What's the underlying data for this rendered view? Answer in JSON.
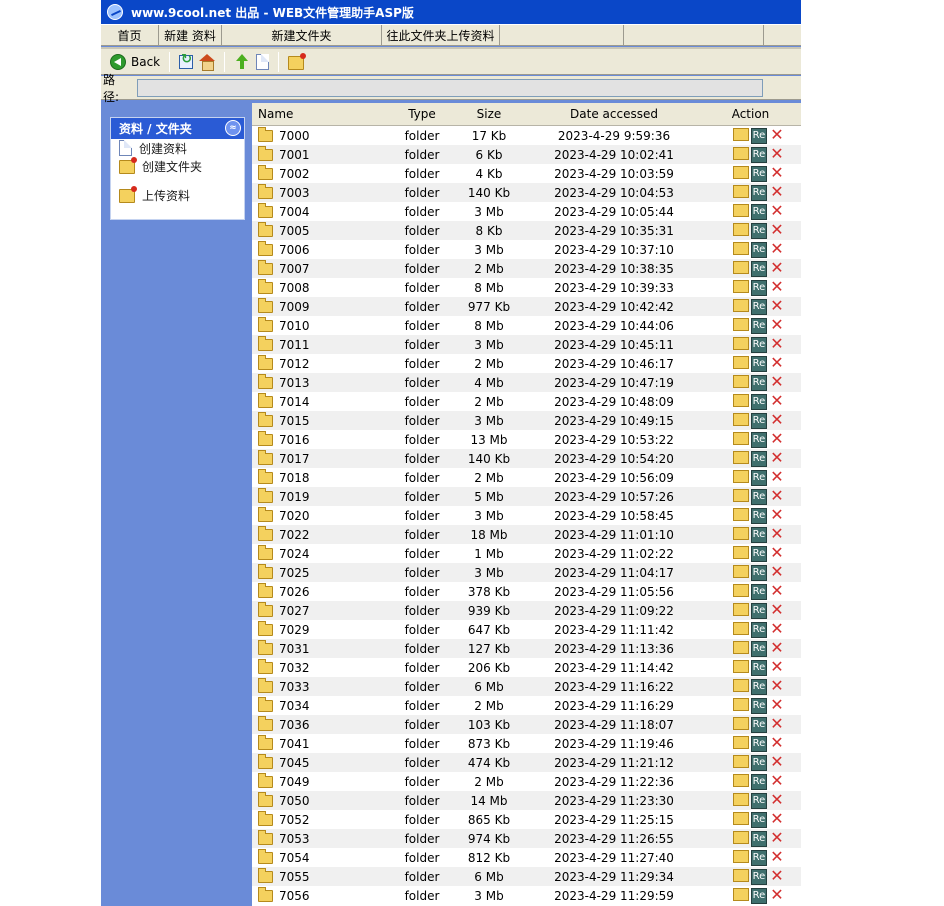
{
  "window": {
    "title": "www.9cool.net 出品 - WEB文件管理助手ASP版"
  },
  "menu": {
    "home": "首页",
    "new_file": "新建 资料",
    "new_folder": "新建文件夹",
    "upload_here": "往此文件夹上传资料"
  },
  "toolbar": {
    "back_label": "Back"
  },
  "path": {
    "label": "路径:",
    "value": ""
  },
  "sidebar": {
    "title": "资料 / 文件夹",
    "toggle_glyph": "≈",
    "items": [
      {
        "label": "创建资料"
      },
      {
        "label": "创建文件夹"
      },
      {
        "label": "上传资料"
      }
    ]
  },
  "table": {
    "headers": {
      "name": "Name",
      "type": "Type",
      "size": "Size",
      "date": "Date accessed",
      "action": "Action"
    },
    "rename_label": "Re",
    "delete_glyph": "✕",
    "rows": [
      {
        "name": "7000",
        "type": "folder",
        "size": "17 Kb",
        "date": "2023-4-29 9:59:36"
      },
      {
        "name": "7001",
        "type": "folder",
        "size": "6 Kb",
        "date": "2023-4-29 10:02:41"
      },
      {
        "name": "7002",
        "type": "folder",
        "size": "4 Kb",
        "date": "2023-4-29 10:03:59"
      },
      {
        "name": "7003",
        "type": "folder",
        "size": "140 Kb",
        "date": "2023-4-29 10:04:53"
      },
      {
        "name": "7004",
        "type": "folder",
        "size": "3 Mb",
        "date": "2023-4-29 10:05:44"
      },
      {
        "name": "7005",
        "type": "folder",
        "size": "8 Kb",
        "date": "2023-4-29 10:35:31"
      },
      {
        "name": "7006",
        "type": "folder",
        "size": "3 Mb",
        "date": "2023-4-29 10:37:10"
      },
      {
        "name": "7007",
        "type": "folder",
        "size": "2 Mb",
        "date": "2023-4-29 10:38:35"
      },
      {
        "name": "7008",
        "type": "folder",
        "size": "8 Mb",
        "date": "2023-4-29 10:39:33"
      },
      {
        "name": "7009",
        "type": "folder",
        "size": "977 Kb",
        "date": "2023-4-29 10:42:42"
      },
      {
        "name": "7010",
        "type": "folder",
        "size": "8 Mb",
        "date": "2023-4-29 10:44:06"
      },
      {
        "name": "7011",
        "type": "folder",
        "size": "3 Mb",
        "date": "2023-4-29 10:45:11"
      },
      {
        "name": "7012",
        "type": "folder",
        "size": "2 Mb",
        "date": "2023-4-29 10:46:17"
      },
      {
        "name": "7013",
        "type": "folder",
        "size": "4 Mb",
        "date": "2023-4-29 10:47:19"
      },
      {
        "name": "7014",
        "type": "folder",
        "size": "2 Mb",
        "date": "2023-4-29 10:48:09"
      },
      {
        "name": "7015",
        "type": "folder",
        "size": "3 Mb",
        "date": "2023-4-29 10:49:15"
      },
      {
        "name": "7016",
        "type": "folder",
        "size": "13 Mb",
        "date": "2023-4-29 10:53:22"
      },
      {
        "name": "7017",
        "type": "folder",
        "size": "140 Kb",
        "date": "2023-4-29 10:54:20"
      },
      {
        "name": "7018",
        "type": "folder",
        "size": "2 Mb",
        "date": "2023-4-29 10:56:09"
      },
      {
        "name": "7019",
        "type": "folder",
        "size": "5 Mb",
        "date": "2023-4-29 10:57:26"
      },
      {
        "name": "7020",
        "type": "folder",
        "size": "3 Mb",
        "date": "2023-4-29 10:58:45"
      },
      {
        "name": "7022",
        "type": "folder",
        "size": "18 Mb",
        "date": "2023-4-29 11:01:10"
      },
      {
        "name": "7024",
        "type": "folder",
        "size": "1 Mb",
        "date": "2023-4-29 11:02:22"
      },
      {
        "name": "7025",
        "type": "folder",
        "size": "3 Mb",
        "date": "2023-4-29 11:04:17"
      },
      {
        "name": "7026",
        "type": "folder",
        "size": "378 Kb",
        "date": "2023-4-29 11:05:56"
      },
      {
        "name": "7027",
        "type": "folder",
        "size": "939 Kb",
        "date": "2023-4-29 11:09:22"
      },
      {
        "name": "7029",
        "type": "folder",
        "size": "647 Kb",
        "date": "2023-4-29 11:11:42"
      },
      {
        "name": "7031",
        "type": "folder",
        "size": "127 Kb",
        "date": "2023-4-29 11:13:36"
      },
      {
        "name": "7032",
        "type": "folder",
        "size": "206 Kb",
        "date": "2023-4-29 11:14:42"
      },
      {
        "name": "7033",
        "type": "folder",
        "size": "6 Mb",
        "date": "2023-4-29 11:16:22"
      },
      {
        "name": "7034",
        "type": "folder",
        "size": "2 Mb",
        "date": "2023-4-29 11:16:29"
      },
      {
        "name": "7036",
        "type": "folder",
        "size": "103 Kb",
        "date": "2023-4-29 11:18:07"
      },
      {
        "name": "7041",
        "type": "folder",
        "size": "873 Kb",
        "date": "2023-4-29 11:19:46"
      },
      {
        "name": "7045",
        "type": "folder",
        "size": "474 Kb",
        "date": "2023-4-29 11:21:12"
      },
      {
        "name": "7049",
        "type": "folder",
        "size": "2 Mb",
        "date": "2023-4-29 11:22:36"
      },
      {
        "name": "7050",
        "type": "folder",
        "size": "14 Mb",
        "date": "2023-4-29 11:23:30"
      },
      {
        "name": "7052",
        "type": "folder",
        "size": "865 Kb",
        "date": "2023-4-29 11:25:15"
      },
      {
        "name": "7053",
        "type": "folder",
        "size": "974 Kb",
        "date": "2023-4-29 11:26:55"
      },
      {
        "name": "7054",
        "type": "folder",
        "size": "812 Kb",
        "date": "2023-4-29 11:27:40"
      },
      {
        "name": "7055",
        "type": "folder",
        "size": "6 Mb",
        "date": "2023-4-29 11:29:34"
      },
      {
        "name": "7056",
        "type": "folder",
        "size": "3 Mb",
        "date": "2023-4-29 11:29:59"
      }
    ]
  }
}
